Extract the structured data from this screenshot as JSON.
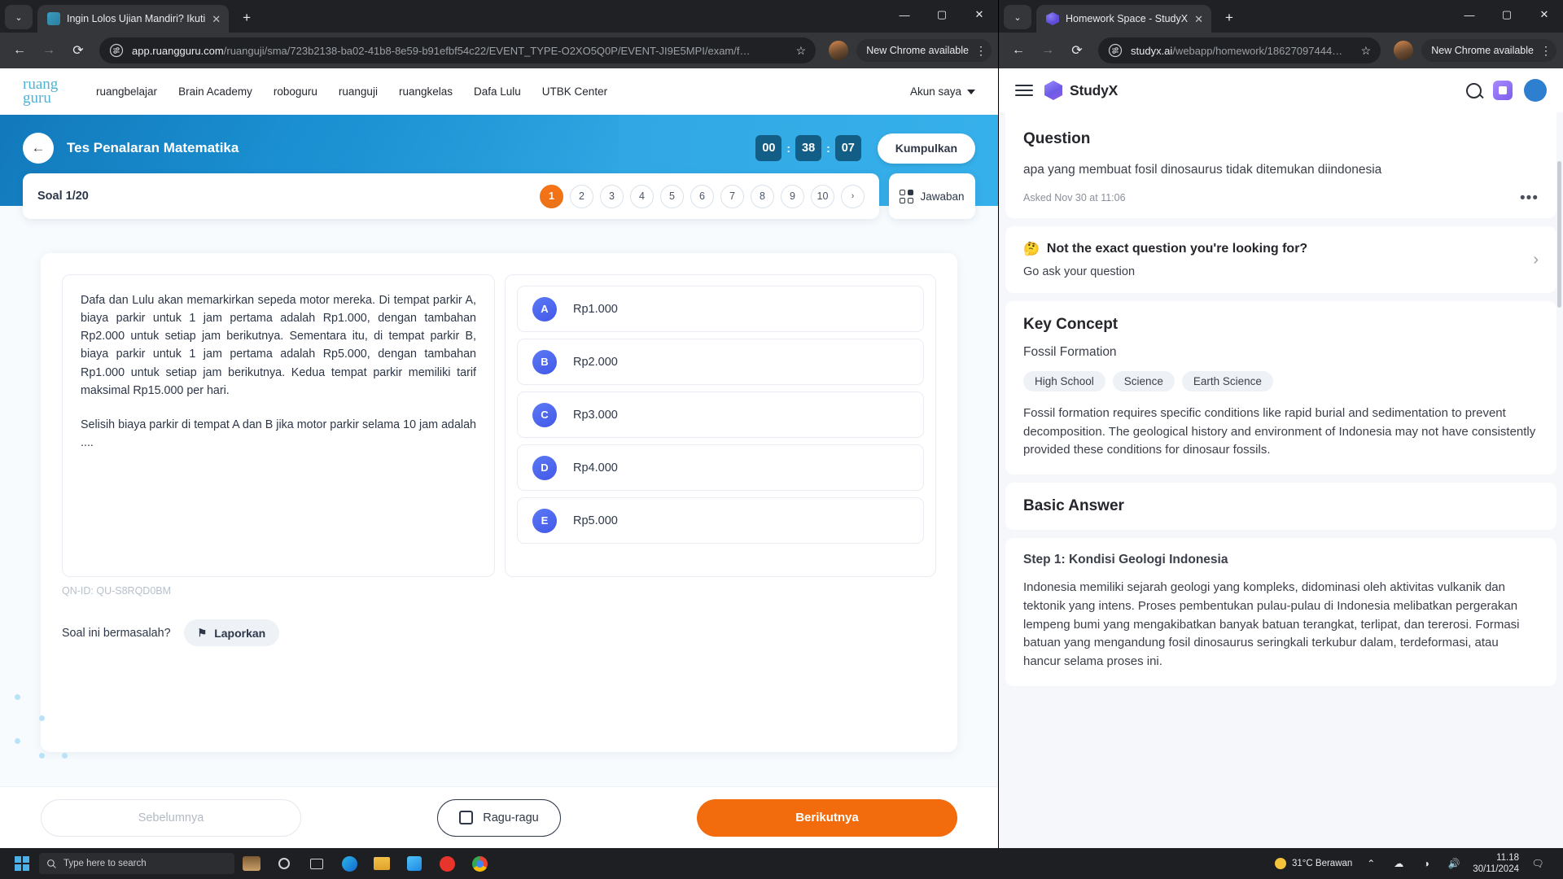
{
  "left_window": {
    "tab": {
      "title": "Ingin Lolos Ujian Mandiri? Ikuti",
      "close": "✕",
      "new_tab": "+",
      "chevron": "⌄"
    },
    "window_controls": {
      "minimize": "—",
      "maximize": "▢",
      "close": "✕"
    },
    "omnibox": {
      "back": "←",
      "forward": "→",
      "reload": "⟳",
      "domain": "app.ruangguru.com",
      "path": "/ruanguji/sma/723b2138-ba02-41b8-8e59-b91efbf54c22/EVENT_TYPE-O2XO5Q0P/EVENT-JI9E5MPI/exam/f…",
      "star": "☆",
      "chrome_update": "New Chrome available",
      "kebab": "⋮"
    },
    "site": {
      "logo_line1": "ruang",
      "logo_line2": "guru",
      "menu": [
        "ruangbelajar",
        "Brain Academy",
        "roboguru",
        "ruanguji",
        "ruangkelas",
        "Dafa Lulu",
        "UTBK Center"
      ],
      "account": "Akun saya",
      "hero": {
        "back_icon": "←",
        "title": "Tes Penalaran Matematika",
        "timer": {
          "hours": "00",
          "minutes": "38",
          "seconds": "07",
          "separator": ":"
        },
        "submit_label": "Kumpulkan"
      },
      "subnav": {
        "soal_label": "Soal 1/20",
        "question_numbers": [
          "1",
          "2",
          "3",
          "4",
          "5",
          "6",
          "7",
          "8",
          "9",
          "10"
        ],
        "active_number": "1",
        "next_arrow": "›",
        "jawaban_label": "Jawaban"
      },
      "question": {
        "paragraph1": "Dafa dan Lulu akan memarkirkan sepeda motor mereka. Di tempat parkir A, biaya parkir untuk 1 jam pertama adalah Rp1.000, dengan tambahan Rp2.000 untuk setiap jam berikutnya. Sementara itu, di tempat parkir B, biaya parkir untuk 1 jam pertama adalah Rp5.000, dengan tambahan Rp1.000 untuk setiap jam berikutnya. Kedua tempat parkir memiliki tarif maksimal Rp15.000 per hari.",
        "paragraph2": "Selisih biaya parkir di tempat A dan B jika motor parkir selama 10 jam adalah ....",
        "qn_id": "QN-ID: QU-S8RQD0BM",
        "options": [
          {
            "key": "A",
            "label": "Rp1.000"
          },
          {
            "key": "B",
            "label": "Rp2.000"
          },
          {
            "key": "C",
            "label": "Rp3.000"
          },
          {
            "key": "D",
            "label": "Rp4.000"
          },
          {
            "key": "E",
            "label": "Rp5.000"
          }
        ],
        "report_prompt": "Soal ini bermasalah?",
        "report_button": "Laporkan",
        "flag_icon": "⚑"
      },
      "footer": {
        "previous": "Sebelumnya",
        "doubt": "Ragu-ragu",
        "next": "Berikutnya"
      }
    }
  },
  "right_window": {
    "tab": {
      "title": "Homework Space - StudyX",
      "close": "✕",
      "new_tab": "+",
      "chevron": "⌄"
    },
    "window_controls": {
      "minimize": "—",
      "maximize": "▢",
      "close": "✕"
    },
    "omnibox": {
      "back": "←",
      "forward": "→",
      "reload": "⟳",
      "domain": "studyx.ai",
      "path": "/webapp/homework/18627097444…",
      "star": "☆",
      "chrome_update": "New Chrome available",
      "kebab": "⋮"
    },
    "app": {
      "brand": "StudyX",
      "avatar_initial": "",
      "question_card": {
        "heading": "Question",
        "text": "apa yang membuat fosil dinosaurus tidak ditemukan diindonesia",
        "asked": "Asked Nov 30 at 11:06",
        "more": "•••"
      },
      "not_exact": {
        "emoji": "🤔",
        "title": "Not the exact question you're looking for?",
        "subtitle": "Go ask your question",
        "chevron": "›"
      },
      "key_concept": {
        "heading": "Key Concept",
        "concept": "Fossil Formation",
        "tags": [
          "High School",
          "Science",
          "Earth Science"
        ],
        "body": "Fossil formation requires specific conditions like rapid burial and sedimentation to prevent decomposition. The geological history and environment of Indonesia may not have consistently provided these conditions for dinosaur fossils."
      },
      "basic_answer": {
        "heading": "Basic Answer",
        "step_title": "Step 1: Kondisi Geologi Indonesia",
        "step_body": "Indonesia memiliki sejarah geologi yang kompleks, didominasi oleh aktivitas vulkanik dan tektonik yang intens. Proses pembentukan pulau-pulau di Indonesia melibatkan pergerakan lempeng bumi yang mengakibatkan banyak batuan terangkat, terlipat, dan tererosi. Formasi batuan yang mengandung fosil dinosaurus seringkali terkubur dalam, terdeformasi, atau hancur selama proses ini."
      }
    }
  },
  "taskbar": {
    "search_placeholder": "Type here to search",
    "weather": "31°C  Berawan",
    "time": "11.18",
    "date": "30/11/2024",
    "show_hidden": "⌃",
    "network": "◑",
    "volume": "🔊",
    "notify": "🗨"
  },
  "colors": {
    "accent_orange": "#f26c0d",
    "hero_blue": "#2ea3e0",
    "option_blue": "#4358e8",
    "studyx_purple": "#7c5cf0"
  }
}
